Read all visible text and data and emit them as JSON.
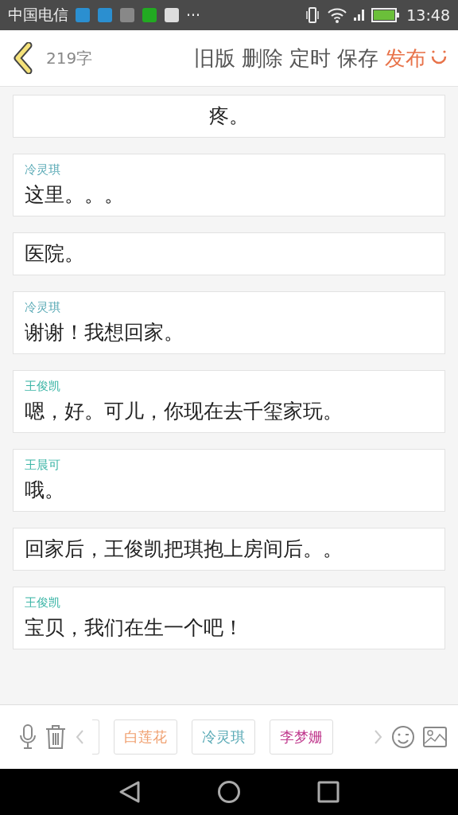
{
  "status_bar": {
    "carrier": "中国电信",
    "more": "···",
    "time": "13:48"
  },
  "toolbar": {
    "word_count": "219字",
    "actions": [
      {
        "label": "旧版",
        "primary": false
      },
      {
        "label": "删除",
        "primary": false
      },
      {
        "label": "定时",
        "primary": false
      },
      {
        "label": "保存",
        "primary": false
      },
      {
        "label": "发布",
        "primary": true
      }
    ]
  },
  "blocks": [
    {
      "kind": "center",
      "text": "疼。"
    },
    {
      "kind": "dialogue",
      "speaker": "冷灵琪",
      "color": "#5aaab6",
      "text": "这里。。。"
    },
    {
      "kind": "narration",
      "text": "医院。"
    },
    {
      "kind": "dialogue",
      "speaker": "冷灵琪",
      "color": "#5aaab6",
      "text": "谢谢！我想回家。"
    },
    {
      "kind": "dialogue",
      "speaker": "王俊凯",
      "color": "#3bb5a6",
      "text": "嗯，好。可儿，你现在去千玺家玩。"
    },
    {
      "kind": "dialogue",
      "speaker": "王晨可",
      "color": "#3bb5a6",
      "text": "哦。"
    },
    {
      "kind": "narration",
      "text": "回家后，王俊凯把琪抱上房间后。。"
    },
    {
      "kind": "dialogue",
      "speaker": "王俊凯",
      "color": "#3bb5a6",
      "text": "宝贝，我们在生一个吧！"
    }
  ],
  "characters": [
    {
      "name": "白莲花",
      "color": "#f0a070"
    },
    {
      "name": "冷灵琪",
      "color": "#5aaab6"
    },
    {
      "name": "李梦姗",
      "color": "#c03a8e"
    }
  ]
}
